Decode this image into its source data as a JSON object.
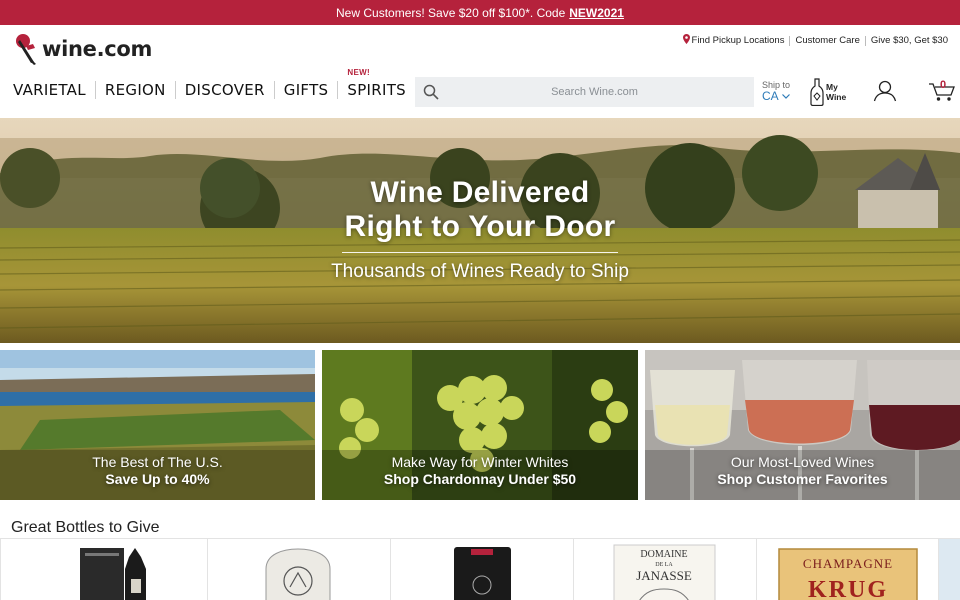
{
  "promo": {
    "text": "New Customers! Save $20 off $100*. Code",
    "code": "NEW2021"
  },
  "logo": {
    "text": "wine.com"
  },
  "utility": {
    "pickup": "Find Pickup Locations",
    "care": "Customer Care",
    "give": "Give $30, Get $30"
  },
  "nav": {
    "items": [
      "VARIETAL",
      "REGION",
      "DISCOVER",
      "GIFTS",
      "SPIRITS"
    ],
    "new_badge": "NEW!"
  },
  "search": {
    "placeholder": "Search Wine.com"
  },
  "ship": {
    "label": "Ship to",
    "state": "CA"
  },
  "mywine": {
    "line1": "My",
    "line2": "Wine"
  },
  "cart": {
    "count": "0"
  },
  "hero": {
    "line1": "Wine Delivered",
    "line2": "Right to Your Door",
    "subtitle": "Thousands of Wines Ready to Ship"
  },
  "tiles": [
    {
      "line1": "The Best of The U.S.",
      "line2": "Save Up to 40%"
    },
    {
      "line1": "Make Way for Winter Whites",
      "line2": "Shop Chardonnay Under $50"
    },
    {
      "line1": "Our Most-Loved Wines",
      "line2": "Shop Customer Favorites"
    }
  ],
  "section": {
    "title": "Great Bottles to Give"
  },
  "products": [
    {
      "label": ""
    },
    {
      "label": ""
    },
    {
      "label": ""
    },
    {
      "label_top": "DOMAINE",
      "label_mid": "DE LA",
      "label_main": "JANASSE"
    },
    {
      "label_top": "CHAMPAGNE",
      "label_main": "KRUG"
    }
  ],
  "colors": {
    "brand": "#b5223c",
    "link": "#2d7bb8",
    "search_bg": "#edeff1"
  }
}
